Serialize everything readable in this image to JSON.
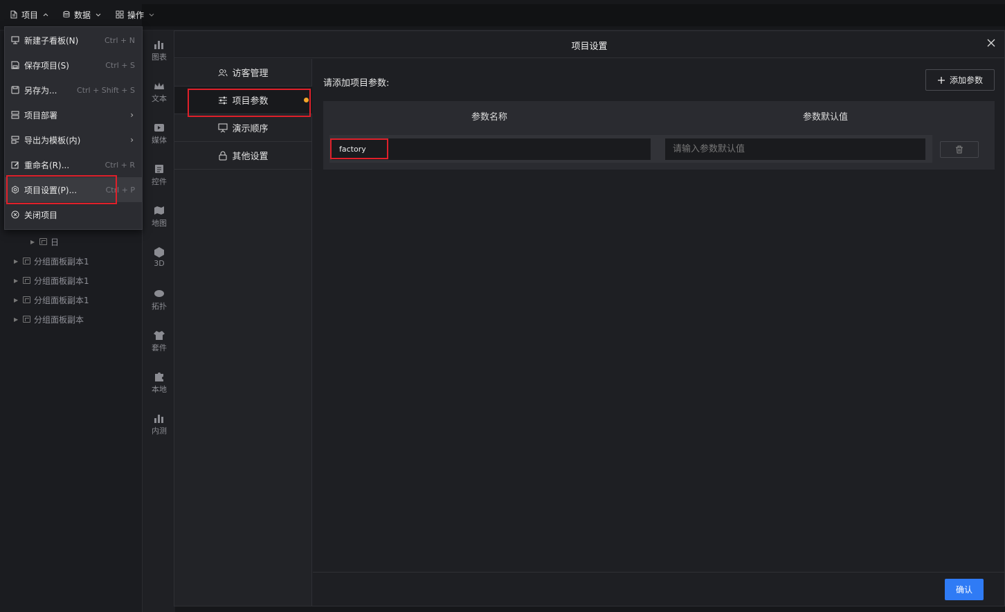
{
  "topbar": {
    "menus": [
      {
        "label": "项目",
        "icon": "file-icon"
      },
      {
        "label": "数据",
        "icon": "database-icon"
      },
      {
        "label": "操作",
        "icon": "grid-icon"
      }
    ]
  },
  "dropdown": {
    "items": [
      {
        "label": "新建子看板(N)",
        "shortcut": "Ctrl + N",
        "icon": "board-icon"
      },
      {
        "label": "保存项目(S)",
        "shortcut": "Ctrl + S",
        "icon": "save-icon"
      },
      {
        "label": "另存为...",
        "shortcut": "Ctrl + Shift + S",
        "icon": "save-as-icon"
      },
      {
        "label": "项目部署",
        "shortcut": "",
        "icon": "deploy-icon",
        "submenu": true
      },
      {
        "label": "导出为模板(内)",
        "shortcut": "",
        "icon": "export-icon",
        "submenu": true
      },
      {
        "label": "重命名(R)...",
        "shortcut": "Ctrl + R",
        "icon": "rename-icon"
      },
      {
        "label": "项目设置(P)...",
        "shortcut": "Ctrl + P",
        "icon": "settings-icon"
      },
      {
        "label": "关闭项目",
        "shortcut": "",
        "icon": "close-circle-icon"
      }
    ]
  },
  "tree": {
    "items": [
      {
        "label": "日"
      },
      {
        "label": "分组面板副本1"
      },
      {
        "label": "分组面板副本1"
      },
      {
        "label": "分组面板副本1"
      },
      {
        "label": "分组面板副本"
      }
    ]
  },
  "tools": [
    {
      "label": "图表"
    },
    {
      "label": "文本"
    },
    {
      "label": "媒体"
    },
    {
      "label": "控件"
    },
    {
      "label": "地图"
    },
    {
      "label": "3D"
    },
    {
      "label": "拓扑"
    },
    {
      "label": "套件"
    },
    {
      "label": "本地"
    },
    {
      "label": "内测"
    }
  ],
  "modal": {
    "title": "项目设置",
    "nav": [
      {
        "label": "访客管理"
      },
      {
        "label": "项目参数"
      },
      {
        "label": "演示顺序"
      },
      {
        "label": "其他设置"
      }
    ],
    "content_title": "请添加项目参数:",
    "add_button": "添加参数",
    "columns": [
      "参数名称",
      "参数默认值"
    ],
    "param": {
      "name": "factory",
      "default_placeholder": "请输入参数默认值"
    },
    "confirm": "确认"
  },
  "colors": {
    "accent": "#2f7bf5",
    "highlight_box": "#e0202a",
    "unsaved_dot": "#f2a52a"
  }
}
